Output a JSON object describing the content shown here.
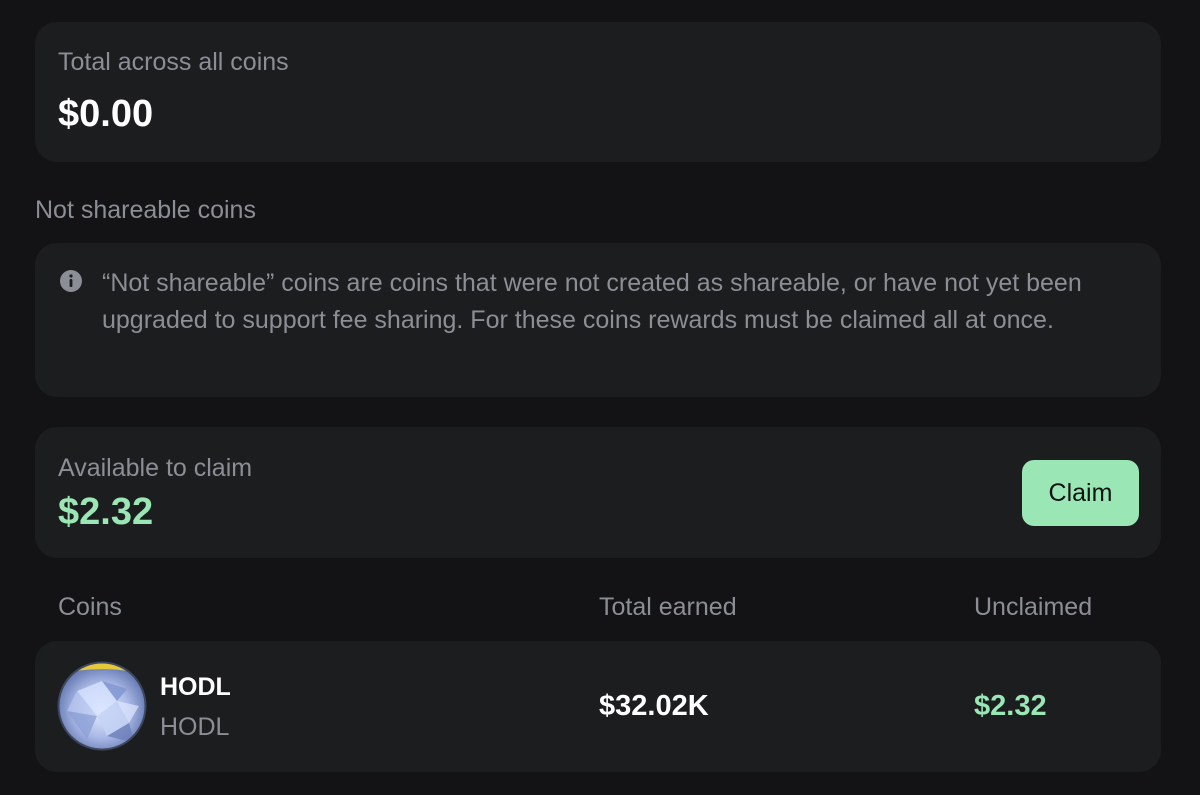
{
  "total": {
    "label": "Total across all coins",
    "value": "$0.00"
  },
  "not_shareable": {
    "heading": "Not shareable coins",
    "info_icon": "info-icon",
    "info_text": "“Not shareable” coins are coins that were not created as shareable, or have not yet been upgraded to support fee sharing. For these coins rewards must be claimed all at once."
  },
  "claim": {
    "label": "Available to claim",
    "value": "$2.32",
    "button_label": "Claim"
  },
  "table": {
    "headers": [
      "Coins",
      "Total earned",
      "Unclaimed"
    ],
    "rows": [
      {
        "name": "HODL",
        "ticker": "HODL",
        "total_earned": "$32.02K",
        "unclaimed": "$2.32",
        "avatar_icon": "coin-avatar-icon"
      }
    ]
  },
  "colors": {
    "background": "#131315",
    "card": "#1c1d1f",
    "muted_text": "#8c8e95",
    "accent_green": "#9ae6b4"
  }
}
